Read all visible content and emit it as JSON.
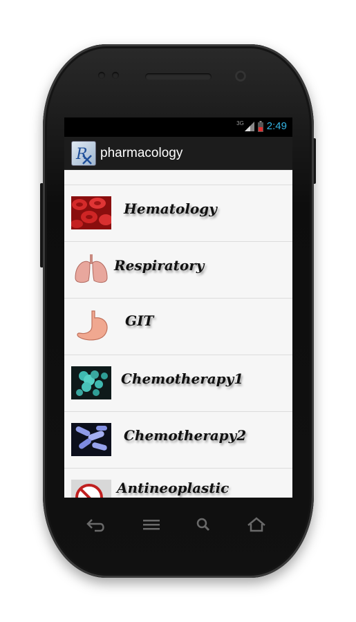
{
  "status_bar": {
    "time": "2:49",
    "network_label": "3G",
    "signal_icon": "signal-icon",
    "battery_icon": "battery-low-icon"
  },
  "action_bar": {
    "title": "pharmacology",
    "app_icon": "rx-app-icon"
  },
  "list": {
    "items": [
      {
        "label": "Hematology",
        "icon": "blood-cells-image"
      },
      {
        "label": "Respiratory",
        "icon": "lungs-image"
      },
      {
        "label": "GIT",
        "icon": "stomach-image"
      },
      {
        "label": "Chemotherapy1",
        "icon": "bacteria-teal-image"
      },
      {
        "label": "Chemotherapy2",
        "icon": "bacteria-blue-image"
      },
      {
        "label": "Antineoplastic",
        "icon": "no-cancer-image"
      }
    ]
  },
  "nav_bar": {
    "back_icon": "back-icon",
    "menu_icon": "menu-icon",
    "search_icon": "search-icon",
    "home_icon": "home-icon"
  },
  "colors": {
    "time_accent": "#33b5e5",
    "action_bar_bg": "#1c1c1c",
    "list_bg": "#f6f6f6"
  }
}
